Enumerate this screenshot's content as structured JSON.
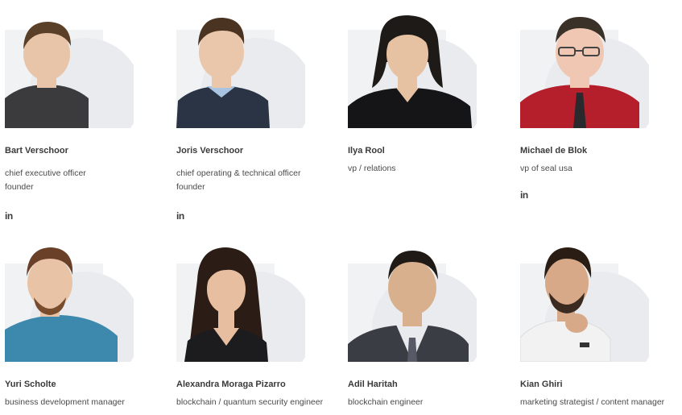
{
  "team": [
    {
      "name": "Bart Verschoor",
      "roles": [
        "chief executive officer",
        "founder"
      ],
      "linkedin": "in",
      "skin": "#e8c4a8",
      "hair": "#5a4028",
      "shirt": "#3b3b3d"
    },
    {
      "name": "Joris Verschoor",
      "roles": [
        "chief operating & technical officer",
        "founder"
      ],
      "linkedin": "in",
      "skin": "#eac7aa",
      "hair": "#4a3320",
      "shirt": "#2b3444"
    },
    {
      "name": "Ilya Rool",
      "roles": [
        "vp / relations"
      ],
      "linkedin": "",
      "skin": "#e6c2a2",
      "hair": "#1e1a17",
      "shirt": "#151517"
    },
    {
      "name": "Michael de Blok",
      "roles": [
        "vp of seal usa"
      ],
      "linkedin": "in",
      "skin": "#efc7b2",
      "hair": "#3a3129",
      "shirt": "#b51f2b"
    },
    {
      "name": "Yuri Scholte",
      "roles": [
        "business development manager"
      ],
      "linkedin": "",
      "skin": "#e9c3a6",
      "hair": "#6a4128",
      "shirt": "#3d88ad"
    },
    {
      "name": "Alexandra Moraga Pizarro",
      "roles": [
        "blockchain / quantum security engineer"
      ],
      "linkedin": "",
      "skin": "#e7bfa0",
      "hair": "#2b1d15",
      "shirt": "#1c1c1e"
    },
    {
      "name": "Adil Haritah",
      "roles": [
        "blockchain engineer"
      ],
      "linkedin": "",
      "skin": "#d9b08e",
      "hair": "#1f1a16",
      "shirt": "#3a3d44"
    },
    {
      "name": "Kian Ghiri",
      "roles": [
        "marketing strategist / content manager"
      ],
      "linkedin": "",
      "skin": "#d7a988",
      "hair": "#2a1d14",
      "shirt": "#f2f2f2"
    }
  ]
}
